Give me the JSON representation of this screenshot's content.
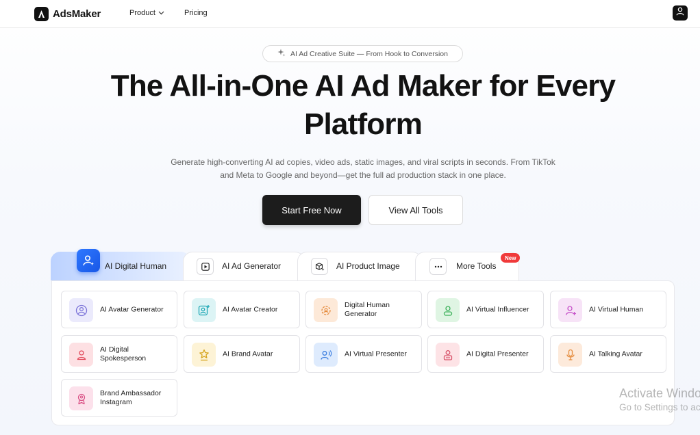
{
  "header": {
    "brand": "AdsMaker",
    "nav": [
      {
        "label": "Product",
        "has_dropdown": true
      },
      {
        "label": "Pricing",
        "has_dropdown": false
      }
    ],
    "user_icon": "user-icon"
  },
  "hero": {
    "pill_icon": "sparkle-icon",
    "pill_text": "AI Ad Creative Suite — From Hook to Conversion",
    "title_line1": "The All-in-One AI Ad Maker for Every",
    "title_line2": "Platform",
    "subtitle_line1": "Generate high-converting AI ad copies, video ads, static images, and viral scripts in seconds. From TikTok",
    "subtitle_line2": "and Meta to Google and beyond—get the full ad production stack in one place.",
    "primary_cta": "Start Free Now",
    "secondary_cta": "View All Tools"
  },
  "tabs": [
    {
      "label": "AI Digital Human",
      "icon": "digital-human-icon",
      "active": true
    },
    {
      "label": "AI Ad Generator",
      "icon": "play-icon",
      "active": false
    },
    {
      "label": "AI Product Image",
      "icon": "box-sparkle-icon",
      "active": false
    },
    {
      "label": "More Tools",
      "icon": "more-dots-icon",
      "active": false,
      "badge": "New"
    }
  ],
  "tools": [
    {
      "label": "AI Avatar Generator",
      "icon": "avatar-circle-icon",
      "bg": "#ebeafc",
      "fg": "#7b73d9"
    },
    {
      "label": "AI Avatar Creator",
      "icon": "avatar-plus-icon",
      "bg": "#dcf4f5",
      "fg": "#1fa8b5"
    },
    {
      "label": "Digital Human Generator",
      "icon": "gear-user-icon",
      "bg": "#fde9d8",
      "fg": "#e58a3b"
    },
    {
      "label": "AI Virtual Influencer",
      "icon": "influencer-icon",
      "bg": "#dff5e3",
      "fg": "#3cb15a"
    },
    {
      "label": "AI Virtual Human",
      "icon": "virtual-human-icon",
      "bg": "#f7e3f7",
      "fg": "#c653c9"
    },
    {
      "label": "AI Digital Spokesperson",
      "icon": "spokesperson-icon",
      "bg": "#fde0e3",
      "fg": "#e24a5c"
    },
    {
      "label": "AI Brand Avatar",
      "icon": "star-user-icon",
      "bg": "#fdf3d6",
      "fg": "#d6a520"
    },
    {
      "label": "AI Virtual Presenter",
      "icon": "presenter-icon",
      "bg": "#deebfd",
      "fg": "#3d7fe0"
    },
    {
      "label": "AI Digital Presenter",
      "icon": "digital-presenter-icon",
      "bg": "#fde3e6",
      "fg": "#d9536a"
    },
    {
      "label": "AI Talking Avatar",
      "icon": "microphone-icon",
      "bg": "#fdeadb",
      "fg": "#e58a3b"
    },
    {
      "label": "Brand Ambassador Instagram",
      "icon": "ambassador-icon",
      "bg": "#fce1eb",
      "fg": "#d94f84"
    }
  ],
  "watermark": {
    "line1": "Activate Windows",
    "line2": "Go to Settings to activate Windows."
  }
}
